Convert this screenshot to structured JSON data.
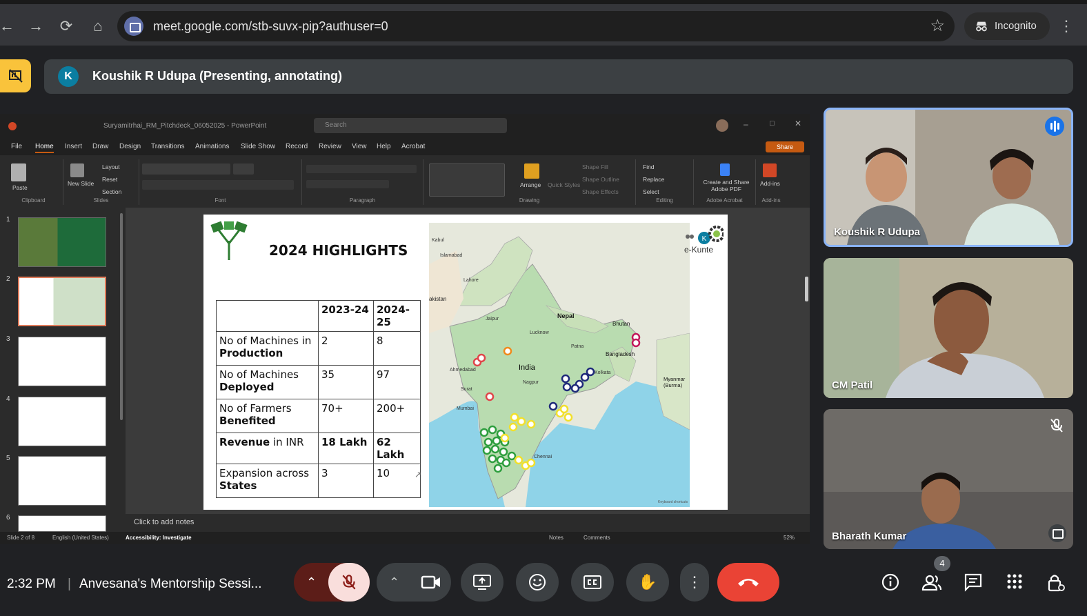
{
  "browser": {
    "url": "meet.google.com/stb-suvx-pip?authuser=0",
    "incognito_label": "Incognito"
  },
  "presenter": {
    "initial": "K",
    "text": "Koushik R Udupa (Presenting, annotating)"
  },
  "powerpoint": {
    "file_name": "Suryamitrhai_RM_Pitchdeck_06052025 - PowerPoint",
    "search_placeholder": "Search",
    "menu": [
      "File",
      "Home",
      "Insert",
      "Draw",
      "Design",
      "Transitions",
      "Animations",
      "Slide Show",
      "Record",
      "Review",
      "View",
      "Help",
      "Acrobat"
    ],
    "share_label": "Share",
    "ribbon_groups": [
      "Clipboard",
      "Slides",
      "Font",
      "Paragraph",
      "Drawing",
      "Editing",
      "Adobe Acrobat",
      "Add-ins"
    ],
    "ribbon_items": {
      "paste": "Paste",
      "new_slide": "New Slide",
      "layout": "Layout",
      "reset": "Reset",
      "section": "Section",
      "arrange": "Arrange",
      "quick_styles": "Quick Styles",
      "shape_fill": "Shape Fill",
      "shape_outline": "Shape Outline",
      "shape_effects": "Shape Effects",
      "find": "Find",
      "replace": "Replace",
      "select": "Select",
      "create_share": "Create and Share Adobe PDF",
      "addins": "Add-ins"
    },
    "thumb_numbers": [
      "1",
      "2",
      "3",
      "4",
      "5",
      "6"
    ],
    "notes_placeholder": "Click to add notes",
    "status": {
      "slide_info": "Slide 2 of 8",
      "language": "English (United States)",
      "accessibility": "Accessibility: Investigate",
      "notes": "Notes",
      "comments": "Comments",
      "zoom": "52%"
    }
  },
  "slide": {
    "title": "2024 HIGHLIGHTS",
    "table": {
      "headers": [
        "",
        "2023-24",
        "2024-25"
      ],
      "rows": [
        {
          "label_a": "No of Machines in ",
          "label_b": "Production",
          "v1": "2",
          "v2": "8",
          "bold_values": false
        },
        {
          "label_a": "No of Machines ",
          "label_b": "Deployed",
          "v1": "35",
          "v2": "97",
          "bold_values": false
        },
        {
          "label_a": "No of Farmers ",
          "label_b": "Benefited",
          "v1": "70+",
          "v2": "200+",
          "bold_values": false
        },
        {
          "label_a": "Revenue",
          "label_b": " in INR",
          "v1": "18 Lakh",
          "v2": "62 Lakh",
          "bold_values": true
        },
        {
          "label_a": "Expansion across ",
          "label_b": "States",
          "v1": "3",
          "v2": "10",
          "bold_values": false
        }
      ]
    },
    "map_labels": {
      "india": "India",
      "nepal": "Nepal",
      "bhutan": "Bhutan",
      "bangladesh": "Bangladesh",
      "myanmar": "Myanmar (Burma)",
      "kabul": "Kabul",
      "islamabad": "Islamabad",
      "lahore": "Lahore",
      "akistan": "akistan",
      "jaipur": "Jaipur",
      "lucknow": "Lucknow",
      "patna": "Patna",
      "kolkata": "Kolkata",
      "ahmedabad": "Ahmedabad",
      "nagpur": "Nagpur",
      "mumbai": "Mumbai",
      "surat": "Surat",
      "chennai": "Chennai",
      "keyboard_shortcuts": "Keyboard shortcuts"
    },
    "ekunte_label": "e-Kunte",
    "marker_colors": {
      "green": "#2e9e3e",
      "yellow": "#f2e02b",
      "navy": "#1f2a7a",
      "red": "#e0464a",
      "orange": "#f08a1c",
      "magenta": "#c2185b"
    }
  },
  "participants": [
    {
      "name": "Koushik R Udupa",
      "speaking": true
    },
    {
      "name": "CM Patil",
      "speaking": false
    },
    {
      "name": "Bharath Kumar",
      "speaking": false,
      "muted": true
    }
  ],
  "bottom": {
    "time": "2:32 PM",
    "separator": "|",
    "meeting_title": "Anvesana's Mentorship Sessi...",
    "people_count": "4"
  }
}
